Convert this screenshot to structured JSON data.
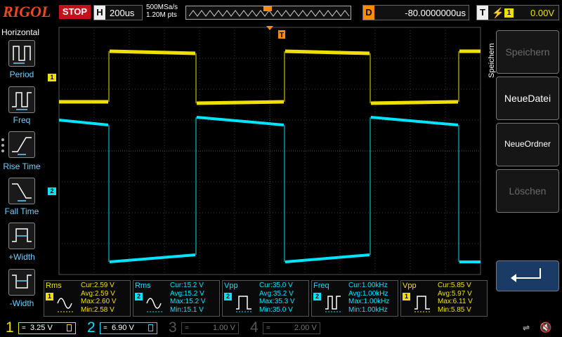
{
  "header": {
    "brand": "RIGOL",
    "run_state": "STOP",
    "horizontal": {
      "label": "H",
      "timebase": "200us"
    },
    "sample_rate": "500MSa/s",
    "memory_depth": "1.20M pts",
    "delay": {
      "label": "D",
      "value": "-80.0000000us"
    },
    "trigger": {
      "label": "T",
      "source": "1",
      "level": "0.00V"
    }
  },
  "left_menu": {
    "title": "Horizontal",
    "items": [
      {
        "label": "Period",
        "icon": "period-icon"
      },
      {
        "label": "Freq",
        "icon": "freq-icon"
      },
      {
        "label": "Rise Time",
        "icon": "rise-time-icon"
      },
      {
        "label": "Fall Time",
        "icon": "fall-time-icon"
      },
      {
        "label": "+Width",
        "icon": "positive-width-icon"
      },
      {
        "label": "-Width",
        "icon": "negative-width-icon"
      }
    ]
  },
  "right_menu": {
    "title": "Speichern",
    "softkeys": [
      {
        "label": "Speichern",
        "enabled": false
      },
      {
        "label": "NeueDatei",
        "enabled": true
      },
      {
        "label": "NeueOrdner",
        "enabled": true
      },
      {
        "label": "Löschen",
        "enabled": false
      }
    ],
    "return_icon": "return-arrow-icon"
  },
  "markers": {
    "ch1": "1",
    "ch2": "2"
  },
  "measurements": [
    {
      "name": "Rms",
      "channel": "1",
      "color": "#f0e000",
      "cur": "Cur:2.59 V",
      "avg": "Avg:2.59 V",
      "max": "Max:2.60 V",
      "min": "Min:2.58 V",
      "icon": "rms-icon"
    },
    {
      "name": "Rms",
      "channel": "2",
      "color": "#00e5ff",
      "cur": "Cur:15.2 V",
      "avg": "Avg:15.2 V",
      "max": "Max:15.2 V",
      "min": "Min:15.1 V",
      "icon": "rms-icon"
    },
    {
      "name": "Vpp",
      "channel": "2",
      "color": "#00e5ff",
      "cur": "Cur:35.0 V",
      "avg": "Avg:35.2 V",
      "max": "Max:35.3 V",
      "min": "Min:35.0 V",
      "icon": "vpp-icon"
    },
    {
      "name": "Freq",
      "channel": "2",
      "color": "#00e5ff",
      "cur": "Cur:1.00kHz",
      "avg": "Avg:1.00kHz",
      "max": "Max:1.00kHz",
      "min": "Min:1.00kHz",
      "icon": "freq-icon"
    },
    {
      "name": "Vpp",
      "channel": "1",
      "color": "#f0e000",
      "cur": "Cur:5.85 V",
      "avg": "Avg:5.97 V",
      "max": "Max:6.11 V",
      "min": "Min:5.85 V",
      "icon": "vpp-icon"
    }
  ],
  "channels": [
    {
      "num": "1",
      "scale": "3.25 V",
      "coupling": "=",
      "color": "#f0e000",
      "active": true
    },
    {
      "num": "2",
      "scale": "6.90 V",
      "coupling": "=",
      "color": "#00e5ff",
      "active": true
    },
    {
      "num": "3",
      "scale": "1.00 V",
      "coupling": "=",
      "color": "#b86ad0",
      "active": false
    },
    {
      "num": "4",
      "scale": "2.00 V",
      "coupling": "=",
      "color": "#4a7ad8",
      "active": false
    }
  ],
  "status_icons": [
    "usb-icon",
    "speaker-mute-icon"
  ],
  "colors": {
    "ch1": "#f0e000",
    "ch2": "#00e5ff",
    "stop": "#c8101a",
    "trigger": "#ff8c00",
    "brand": "#e84b1a"
  }
}
